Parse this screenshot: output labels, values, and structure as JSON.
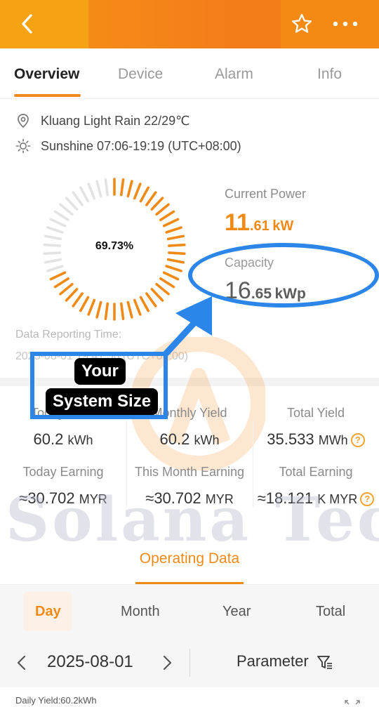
{
  "header": {
    "back_icon": "chevron-left-icon",
    "favorite_icon": "star-icon",
    "more_icon": "more-dots-icon"
  },
  "tabs": [
    {
      "label": "Overview",
      "active": true
    },
    {
      "label": "Device",
      "active": false
    },
    {
      "label": "Alarm",
      "active": false
    },
    {
      "label": "Info",
      "active": false
    }
  ],
  "weather": {
    "icon": "location-pin-icon",
    "text": "Kluang Light Rain 22/29℃"
  },
  "sunshine": {
    "icon": "sun-icon",
    "text": "Sunshine 07:06-19:19 (UTC+08:00)"
  },
  "gauge": {
    "percent_text": "69.73%",
    "fill_ratio": 0.6973,
    "fill_color": "#f08a17",
    "track_color": "#e3e3e3"
  },
  "current_power": {
    "label": "Current Power",
    "value_int": "11",
    "value_dec": ".61",
    "unit": "kW"
  },
  "capacity": {
    "label": "Capacity",
    "value_int": "16",
    "value_dec": ".65",
    "unit": "kWp"
  },
  "report": {
    "label": "Data Reporting Time:",
    "value": "2025-08-01 19:41:56 (UTC+08:00)"
  },
  "annotation": {
    "line1": "Your",
    "line2": "System Size",
    "color": "#2c86ea"
  },
  "stats": {
    "today_yield": {
      "label": "Today Yield",
      "value": "60.2",
      "unit": "kWh"
    },
    "monthly_yield": {
      "label": "Monthly Yield",
      "value": "60.2",
      "unit": "kWh"
    },
    "total_yield": {
      "label": "Total Yield",
      "value": "35.533",
      "unit": "MWh"
    },
    "today_earning": {
      "label": "Today Earning",
      "value": "≈30.702",
      "unit": "MYR"
    },
    "month_earning": {
      "label": "This Month Earning",
      "value": "≈30.702",
      "unit": "MYR"
    },
    "total_earning": {
      "label": "Total Earning",
      "value": "≈18.121",
      "unit": "K MYR"
    }
  },
  "watermark": "Solana Tec",
  "operating_data": {
    "title": "Operating Data"
  },
  "periods": [
    {
      "label": "Day",
      "active": true
    },
    {
      "label": "Month",
      "active": false
    },
    {
      "label": "Year",
      "active": false
    },
    {
      "label": "Total",
      "active": false
    }
  ],
  "date_nav": {
    "date": "2025-08-01",
    "parameter_label": "Parameter"
  },
  "daily_yield_text": "Daily Yield:60.2kWh",
  "colors": {
    "accent": "#f08a17",
    "annotation": "#2c86ea"
  }
}
